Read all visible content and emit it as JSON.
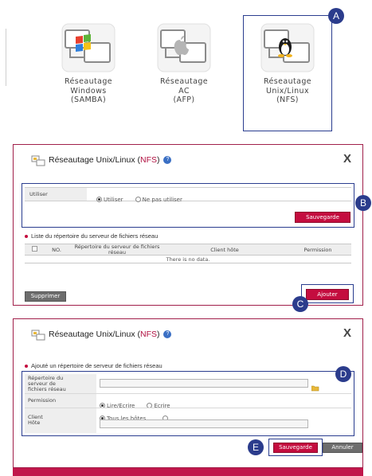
{
  "network_options": [
    {
      "label_lines": [
        "Réseautage",
        "Windows",
        "(SAMBA)"
      ],
      "icon": "windows-network-icon"
    },
    {
      "label_lines": [
        "Réseautage",
        "AC",
        "(AFP)"
      ],
      "icon": "apple-network-icon"
    },
    {
      "label_lines": [
        "Réseautage",
        "Unix/Linux",
        "(NFS)"
      ],
      "icon": "linux-network-icon"
    }
  ],
  "markers": {
    "a": "A",
    "b": "B",
    "c": "C",
    "d": "D",
    "e": "E"
  },
  "dialog1": {
    "title_prefix": "Réseautage Unix/Linux (",
    "title_highlight": "NFS",
    "title_suffix": ")",
    "help_icon": "?",
    "close": "X",
    "use_label": "Utiliser",
    "radio_use": "Utiliser",
    "radio_dont_use": "Ne pas utiliser",
    "use_selected": "Utiliser",
    "save_button": "Sauvegarde",
    "list_title": "Liste du répertoire du serveur de fichiers réseau",
    "table": {
      "columns": [
        "",
        "NO.",
        "Répertoire du serveur de fichiers réseau",
        "Client hôte",
        "Permission"
      ],
      "empty_message": "There is no data."
    },
    "delete_button": "Supprimer",
    "add_button": "Ajouter"
  },
  "dialog2": {
    "title_prefix": "Réseautage Unix/Linux (",
    "title_highlight": "NFS",
    "title_suffix": ")",
    "help_icon": "?",
    "close": "X",
    "section_title": "Ajouté un répertoire de serveur de fichiers réseau",
    "directory_label_lines": [
      "Répertoire du",
      "serveur de",
      "fichiers réseau"
    ],
    "directory_value": "",
    "permission_label": "Permission",
    "perm_rw": "Lire/Ecrire",
    "perm_w": "Ecrire",
    "permission_selected": "Lire/Ecrire",
    "client_label_lines": [
      "Client",
      "Hôte"
    ],
    "all_hosts": "Tous les hôtes",
    "client_host_value": "",
    "save_button": "Sauvegarde",
    "cancel_button": "Annuler"
  },
  "colors": {
    "accent": "#c40d3f",
    "marker": "#2b3c8c",
    "frame": "#a11f4a"
  }
}
